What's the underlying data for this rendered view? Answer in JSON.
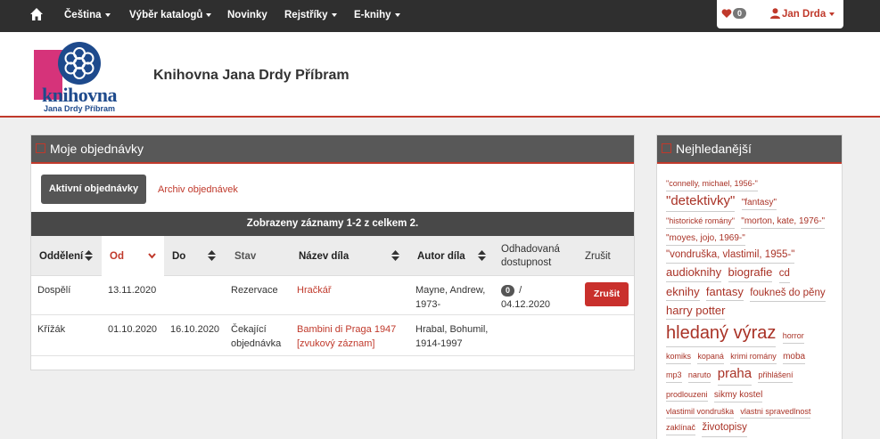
{
  "nav": {
    "items": [
      "Čeština",
      "Výběr katalogů",
      "Novinky",
      "Rejstříky",
      "E-knihy"
    ],
    "favorites_count": "0",
    "user_name": "Jan Drda"
  },
  "header": {
    "logo_word": "knihovna",
    "logo_sub": "Jana Drdy Příbram",
    "site_title": "Knihovna Jana Drdy Příbram"
  },
  "orders": {
    "title": "Moje objednávky",
    "tab_active": "Aktivní objednávky",
    "tab_archive": "Archiv objednávek",
    "results_text": "Zobrazeny záznamy 1-2 z celkem 2.",
    "columns": {
      "department": "Oddělení",
      "from": "Od",
      "to": "Do",
      "status": "Stav",
      "title": "Název díla",
      "author": "Autor díla",
      "availability_l1": "Odhadovaná",
      "availability_l2": "dostupnost",
      "cancel": "Zrušit"
    },
    "rows": [
      {
        "department": "Dospělí",
        "from": "13.11.2020",
        "to": "",
        "status_l1": "Rezervace",
        "status_l2": "",
        "title_l1": "Hračkář",
        "title_l2": "",
        "author_l1": "Mayne, Andrew,",
        "author_l2": "1973-",
        "queue": "0",
        "slash": "/",
        "avail_date": "04.12.2020",
        "cancel_label": "Zrušit"
      },
      {
        "department": "Křížák",
        "from": "01.10.2020",
        "to": "16.10.2020",
        "status_l1": "Čekající",
        "status_l2": "objednávka",
        "title_l1": "Bambini di Praga 1947",
        "title_l2": "[zvukový záznam]",
        "author_l1": "Hrabal, Bohumil,",
        "author_l2": "1914-1997"
      }
    ]
  },
  "popular": {
    "title": "Nejhledanější",
    "tags": [
      {
        "t": "\"connelly, michael, 1956-\"",
        "s": 1
      },
      {
        "t": "\"detektivky\"",
        "s": 5
      },
      {
        "t": "\"fantasy\"",
        "s": 2
      },
      {
        "t": "\"historické romány\"",
        "s": 1
      },
      {
        "t": "\"morton, kate, 1976-\"",
        "s": 2
      },
      {
        "t": "\"moyes, jojo, 1969-\"",
        "s": 2
      },
      {
        "t": "\"vondruška, vlastimil, 1955-\"",
        "s": 3
      },
      {
        "t": "audioknihy",
        "s": 4
      },
      {
        "t": "biografie",
        "s": 4
      },
      {
        "t": "cd",
        "s": 3
      },
      {
        "t": "eknihy",
        "s": 4
      },
      {
        "t": "fantasy",
        "s": 4
      },
      {
        "t": "foukneš do pěny",
        "s": 3
      },
      {
        "t": "harry potter",
        "s": 4
      },
      {
        "t": "hledaný výraz",
        "s": 6
      },
      {
        "t": "horror",
        "s": 1
      },
      {
        "t": "komiks",
        "s": 1
      },
      {
        "t": "kopaná",
        "s": 1
      },
      {
        "t": "krimi romány",
        "s": 1
      },
      {
        "t": "moba",
        "s": 2
      },
      {
        "t": "mp3",
        "s": 1
      },
      {
        "t": "naruto",
        "s": 1
      },
      {
        "t": "praha",
        "s": 5
      },
      {
        "t": "přihlášení",
        "s": 1
      },
      {
        "t": "prodlouzeni",
        "s": 1
      },
      {
        "t": "sikmy kostel",
        "s": 2
      },
      {
        "t": "vlastimil vondruška",
        "s": 1
      },
      {
        "t": "vlastni spravedlnost",
        "s": 1
      },
      {
        "t": "zaklínač",
        "s": 1
      },
      {
        "t": "životopisy",
        "s": 3
      }
    ]
  },
  "colors": {
    "accent": "#c0392b",
    "nav_bg": "#2f2f2f",
    "panel_head": "#585858"
  }
}
